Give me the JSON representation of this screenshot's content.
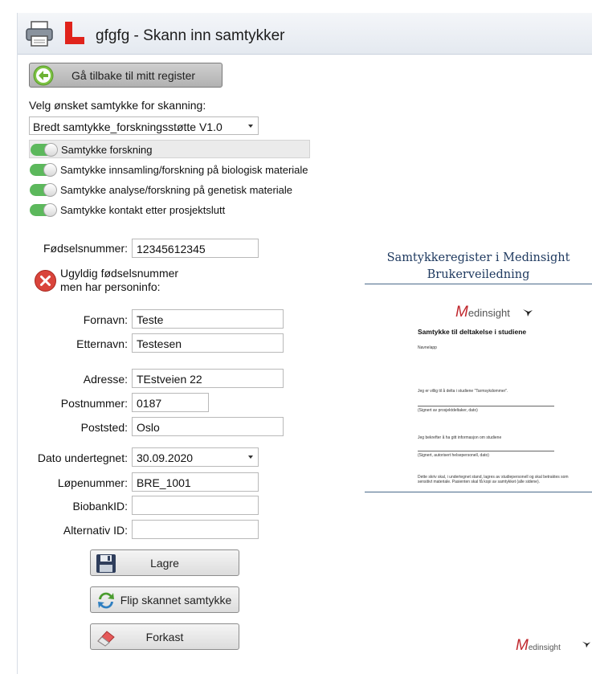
{
  "window": {
    "title": "gfgfg - Skann inn samtykker"
  },
  "back_button": {
    "label": "Gå tilbake til mitt register"
  },
  "consent_select": {
    "prompt": "Velg ønsket samtykke for skanning:",
    "value": "Bredt samtykke_forskningsstøtte V1.0"
  },
  "consent_toggles": [
    {
      "label": "Samtykke forskning",
      "on": true,
      "selected": true
    },
    {
      "label": "Samtykke innsamling/forskning på biologisk materiale",
      "on": true,
      "selected": false
    },
    {
      "label": "Samtykke analyse/forskning på genetisk materiale",
      "on": true,
      "selected": false
    },
    {
      "label": "Samtykke kontakt etter prosjektslutt",
      "on": true,
      "selected": false
    }
  ],
  "form": {
    "ssn": {
      "label": "Fødselsnummer:",
      "value": "12345612345"
    },
    "error_message": {
      "line1": "Ugyldig fødselsnummer",
      "line2": "men har personinfo:"
    },
    "first_name": {
      "label": "Fornavn:",
      "value": "Teste"
    },
    "last_name": {
      "label": "Etternavn:",
      "value": "Testesen"
    },
    "address": {
      "label": "Adresse:",
      "value": "TEstveien 22"
    },
    "postal_code": {
      "label": "Postnummer:",
      "value": "0187"
    },
    "city": {
      "label": "Poststed:",
      "value": "Oslo"
    },
    "date_signed": {
      "label": "Dato undertegnet:",
      "value": "30.09.2020"
    },
    "serial_number": {
      "label": "Løpenummer:",
      "value": "BRE_1001"
    },
    "biobank_id": {
      "label": "BiobankID:",
      "value": ""
    },
    "alternative_id": {
      "label": "Alternativ ID:",
      "value": ""
    }
  },
  "actions": {
    "save": "Lagre",
    "flip": "Flip skannet samtykke",
    "discard": "Forkast"
  },
  "document_preview": {
    "title_line1": "Samtykkeregister i Medinsight",
    "title_line2": "Brukerveiledning",
    "logo_m": "M",
    "logo_rest": "edinsight",
    "heading": "Samtykke til deltakelse i studiene",
    "name_tag": "Navnelapp",
    "line_study": "Jeg er villig til å delta i studiene \"Tarmsykdommer\".",
    "line_sign1": "(Signert av prosjektdeltaker, dato)",
    "line_info": "Jeg bekrefter å ha gitt informasjon om studiene",
    "line_sign2": "(Signert, autorisert helsepersonell, dato)",
    "footer1": "Dette skriv skal, i undertegnet stand, lagres av studiepersonell og skal betraktes som",
    "footer2": "sensitivt materiale. Pasienten skal få kopi av samtykket (alle sidene)."
  },
  "colors": {
    "toggle_on": "#5cb85c",
    "doc_title": "#1f3a60",
    "logo_red": "#c0272d",
    "error_red": "#d9443b"
  }
}
